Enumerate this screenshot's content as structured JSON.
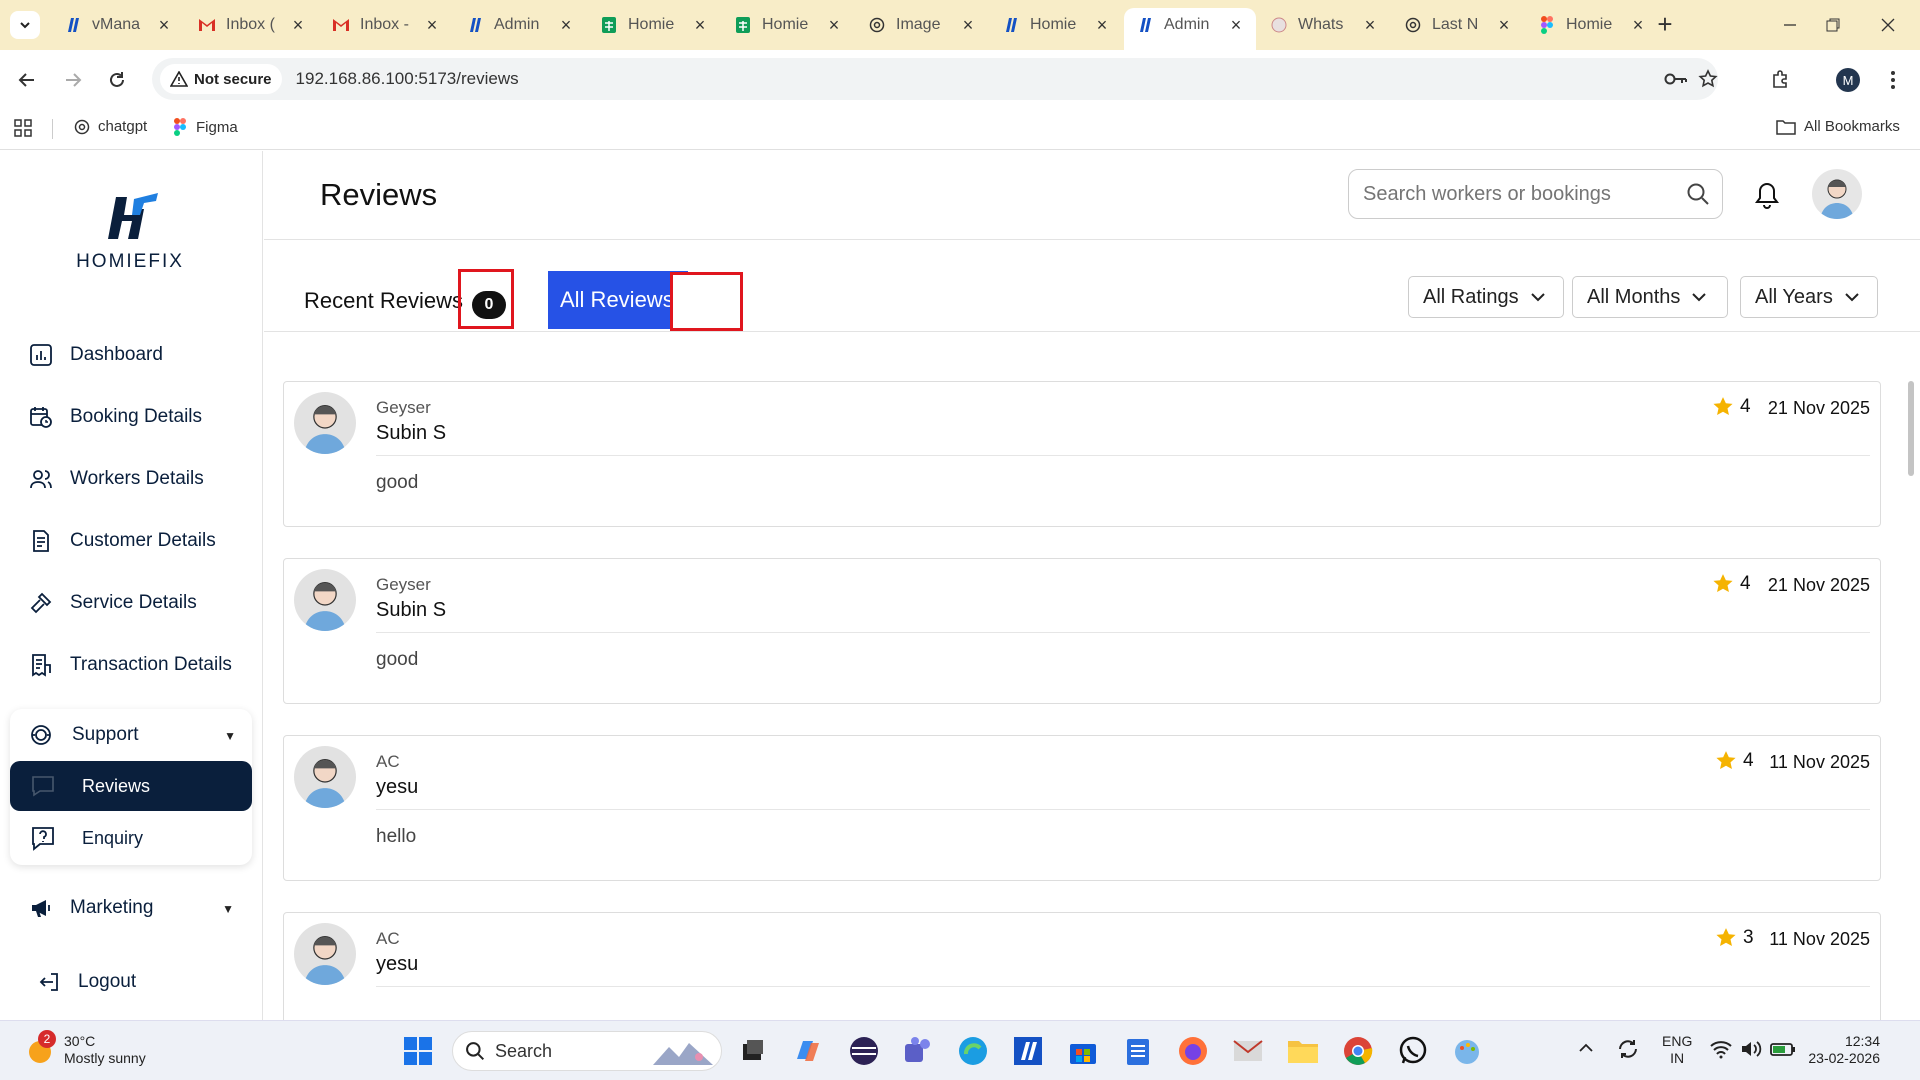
{
  "browser": {
    "tabs": [
      {
        "title": "vMana",
        "icon": "homiefix-icon"
      },
      {
        "title": "Inbox (",
        "icon": "gmail-icon"
      },
      {
        "title": "Inbox -",
        "icon": "gmail-icon"
      },
      {
        "title": "Admin",
        "icon": "homiefix-icon"
      },
      {
        "title": "Homie",
        "icon": "sheets-icon"
      },
      {
        "title": "Homie",
        "icon": "sheets-icon"
      },
      {
        "title": "Image",
        "icon": "chatgpt-icon"
      },
      {
        "title": "Homie",
        "icon": "homiefix-icon"
      },
      {
        "title": "Admin",
        "icon": "homiefix-icon"
      },
      {
        "title": "Whats",
        "icon": "whatsapp-icon"
      },
      {
        "title": "Last N",
        "icon": "chatgpt-icon"
      },
      {
        "title": "Homie",
        "icon": "figma-icon"
      }
    ],
    "active_tab_index": 8,
    "security_label": "Not secure",
    "url": "192.168.86.100:5173/reviews",
    "profile_initial": "M",
    "bookmarks": [
      "chatgpt",
      "Figma"
    ],
    "all_bookmarks": "All Bookmarks"
  },
  "app": {
    "brand": "HOMIEFIX",
    "page_title": "Reviews",
    "search_placeholder": "Search workers or bookings",
    "nav": {
      "dashboard": "Dashboard",
      "booking": "Booking Details",
      "workers": "Workers Details",
      "customer": "Customer Details",
      "service": "Service Details",
      "transaction": "Transaction Details",
      "support": "Support",
      "reviews": "Reviews",
      "enquiry": "Enquiry",
      "marketing": "Marketing",
      "logout": "Logout"
    },
    "tabs": {
      "recent": "Recent Reviews",
      "recent_count": "0",
      "all": "All Reviews"
    },
    "filters": {
      "ratings": "All Ratings",
      "months": "All Months",
      "years": "All Years"
    },
    "reviews": [
      {
        "service": "Geyser",
        "customer": "Subin S",
        "rating": "4",
        "date": "21 Nov 2025",
        "comment": "good"
      },
      {
        "service": "Geyser",
        "customer": "Subin S",
        "rating": "4",
        "date": "21 Nov 2025",
        "comment": "good"
      },
      {
        "service": "AC",
        "customer": "yesu",
        "rating": "4",
        "date": "11 Nov 2025",
        "comment": "hello"
      },
      {
        "service": "AC",
        "customer": "yesu",
        "rating": "3",
        "date": "11 Nov 2025",
        "comment": ""
      }
    ],
    "colors": {
      "navy": "#0a1f3c",
      "accent_blue": "#2652e6",
      "highlight_red": "#e0161e",
      "star": "#f5b301"
    }
  },
  "taskbar": {
    "weather_temp": "30°C",
    "weather_desc": "Mostly sunny",
    "weather_badge": "2",
    "search_label": "Search",
    "lang_1": "ENG",
    "lang_2": "IN",
    "time": "12:34",
    "date": "23-02-2026"
  }
}
